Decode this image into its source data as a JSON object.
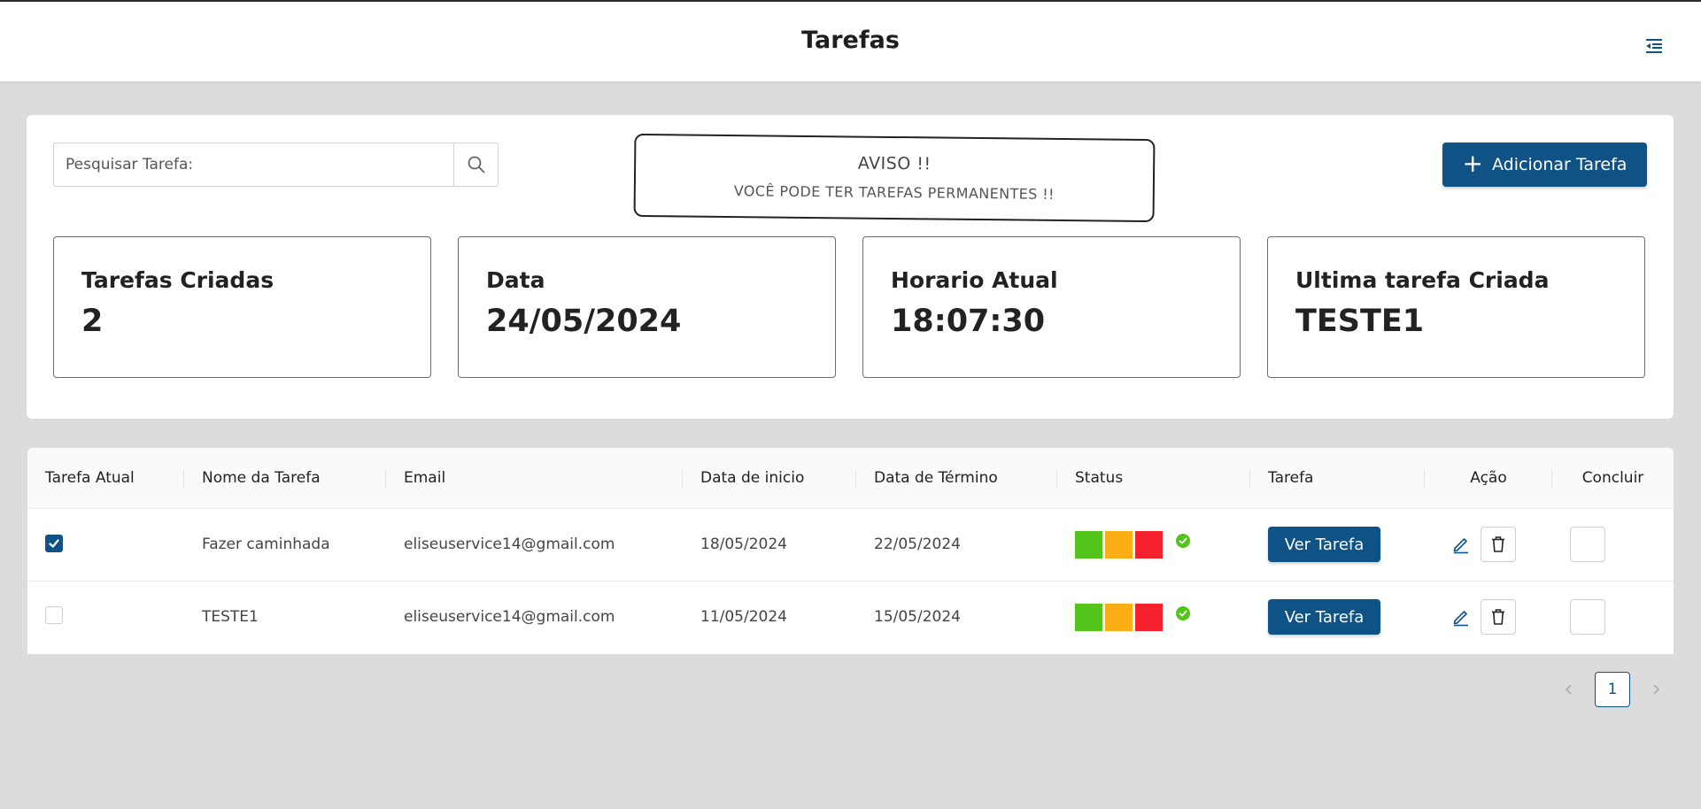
{
  "header": {
    "title": "Tarefas",
    "menu_icon": "collapse-menu-icon"
  },
  "search": {
    "placeholder": "Pesquisar Tarefa:",
    "value": "",
    "icon": "search-icon"
  },
  "notice": {
    "title": "AVISO !!",
    "text": "VOCÊ PODE TER TAREFAS PERMANENTES !!"
  },
  "add_button": {
    "label": "Adicionar Tarefa",
    "icon": "plus-icon"
  },
  "cards": [
    {
      "label": "Tarefas Criadas",
      "value": "2"
    },
    {
      "label": "Data",
      "value": "24/05/2024"
    },
    {
      "label": "Horario Atual",
      "value": "18:07:30"
    },
    {
      "label": "Ultima tarefa Criada",
      "value": "TESTE1"
    }
  ],
  "table": {
    "headers": [
      "Tarefa Atual",
      "Nome da Tarefa",
      "Email",
      "Data de inicio",
      "Data de Término",
      "Status",
      "Tarefa",
      "Ação",
      "Concluir"
    ],
    "rows": [
      {
        "current": true,
        "name": "Fazer caminhada",
        "email": "eliseuservice14@gmail.com",
        "start": "18/05/2024",
        "end": "22/05/2024",
        "view_label": "Ver Tarefa"
      },
      {
        "current": false,
        "name": "TESTE1",
        "email": "eliseuservice14@gmail.com",
        "start": "11/05/2024",
        "end": "15/05/2024",
        "view_label": "Ver Tarefa"
      }
    ]
  },
  "status_colors": [
    "#52c41a",
    "#faad14",
    "#f5222d"
  ],
  "pagination": {
    "current_page": "1"
  },
  "accent_color": "#0f5285"
}
